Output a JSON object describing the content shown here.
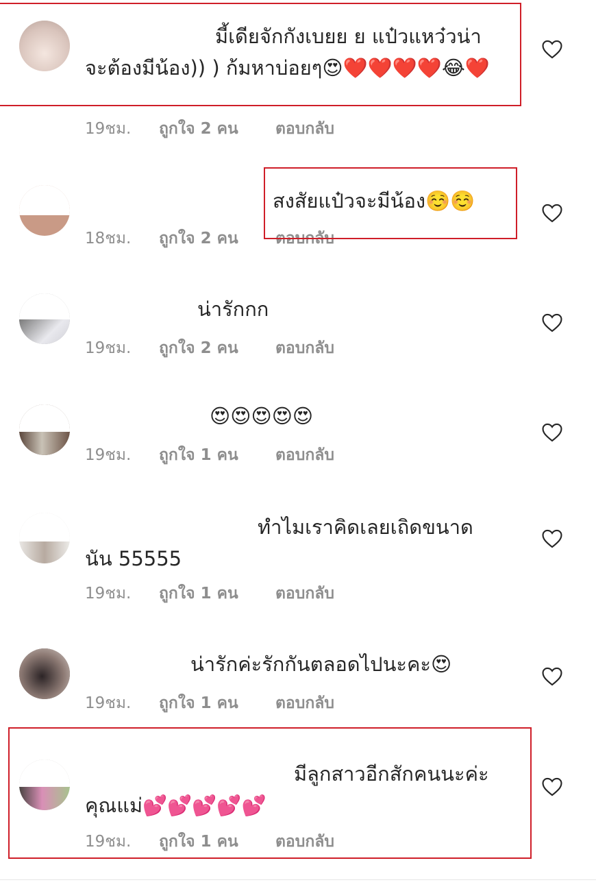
{
  "colors": {
    "meta_text": "#8e8e8e",
    "body_text": "#262626",
    "highlight_border": "#cf1e28",
    "heart_outline": "#262626"
  },
  "comments": [
    {
      "text": "มี้เดียจักกังเบยย ย แป๋วแหว๋วน่าจะต้องมีน้อง)) ) ก้มหาบ่อยๆ😍❤️❤️❤️❤️😂❤️",
      "time": "19ชม.",
      "likes": "ถูกใจ 2 คน",
      "reply": "ตอบกลับ",
      "like_icon": "heart-outline-icon"
    },
    {
      "text": "สงสัยแป๋วจะมีน้อง☺️☺️",
      "time": "18ชม.",
      "likes": "ถูกใจ 2 คน",
      "reply": "ตอบกลับ",
      "like_icon": "heart-outline-icon"
    },
    {
      "text": "น่ารักกก",
      "time": "19ชม.",
      "likes": "ถูกใจ 2 คน",
      "reply": "ตอบกลับ",
      "like_icon": "heart-outline-icon"
    },
    {
      "text": "😍😍😍😍😍",
      "time": "19ชม.",
      "likes": "ถูกใจ 1 คน",
      "reply": "ตอบกลับ",
      "like_icon": "heart-outline-icon"
    },
    {
      "text": "ทำไมเราคิดเลยเถิดขนาดนัน 55555",
      "time": "19ชม.",
      "likes": "ถูกใจ 1 คน",
      "reply": "ตอบกลับ",
      "like_icon": "heart-outline-icon"
    },
    {
      "text": "น่ารักค่ะรักกันตลอดไปนะคะ😍",
      "time": "19ชม.",
      "likes": "ถูกใจ 1 คน",
      "reply": "ตอบกลับ",
      "like_icon": "heart-outline-icon"
    },
    {
      "text": "มีลูกสาวอีกสักคนนะค่ะคุณแม่💕💕💕💕💕",
      "time": "19ชม.",
      "likes": "ถูกใจ 1 คน",
      "reply": "ตอบกลับ",
      "like_icon": "heart-outline-icon"
    }
  ]
}
